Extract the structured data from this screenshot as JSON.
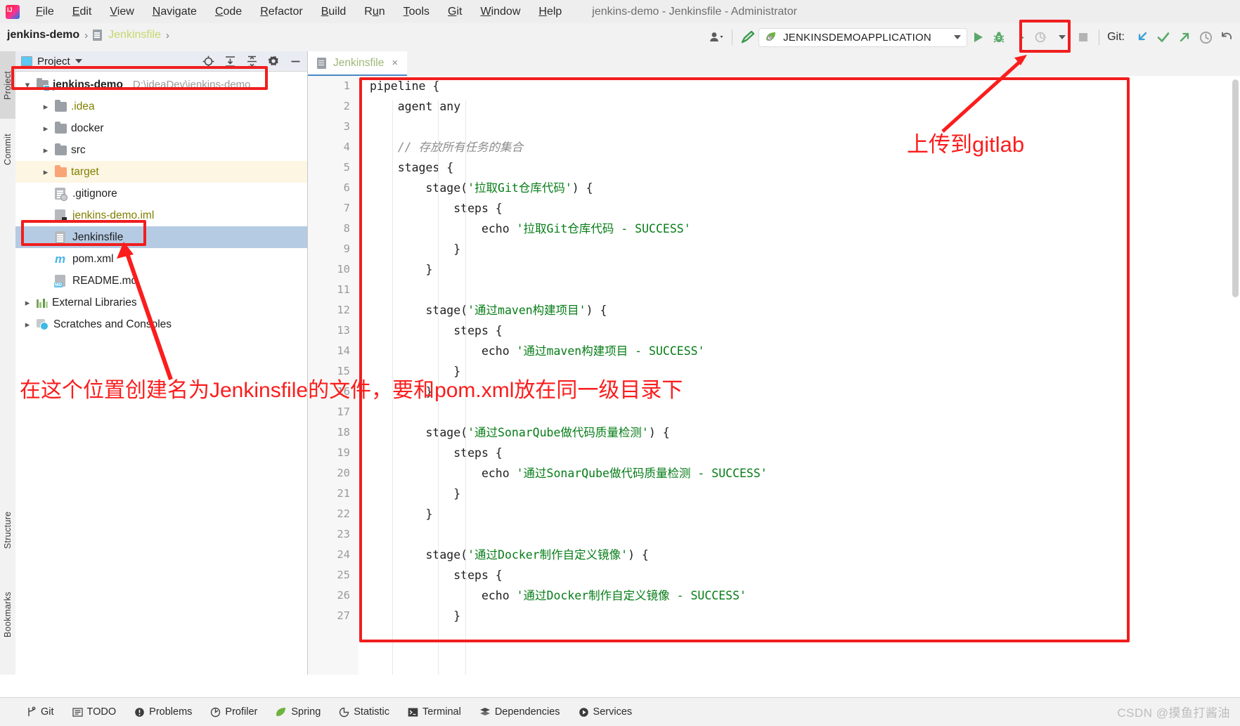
{
  "window": {
    "title": "jenkins-demo - Jenkinsfile - Administrator",
    "app_icon": "intellij-idea-logo"
  },
  "menu": {
    "items": [
      {
        "label": "File",
        "mnemonic": "F"
      },
      {
        "label": "Edit",
        "mnemonic": "E"
      },
      {
        "label": "View",
        "mnemonic": "V"
      },
      {
        "label": "Navigate",
        "mnemonic": "N"
      },
      {
        "label": "Code",
        "mnemonic": "C"
      },
      {
        "label": "Refactor",
        "mnemonic": "R"
      },
      {
        "label": "Build",
        "mnemonic": "B"
      },
      {
        "label": "Run",
        "mnemonic": "u"
      },
      {
        "label": "Tools",
        "mnemonic": "T"
      },
      {
        "label": "Git",
        "mnemonic": "G"
      },
      {
        "label": "Window",
        "mnemonic": "W"
      },
      {
        "label": "Help",
        "mnemonic": "H"
      }
    ]
  },
  "breadcrumb": {
    "project": "jenkins-demo",
    "separator": "›",
    "file": "Jenkinsfile",
    "trailing_separator": "›"
  },
  "toolbar": {
    "run_config": "JENKINSDEMOAPPLICATION",
    "git_label": "Git:",
    "icons": [
      "user-avatar-icon",
      "build-hammer-icon",
      "spring-leaf-icon",
      "run-icon",
      "debug-icon",
      "run-with-coverage-icon",
      "profile-icon",
      "stop-icon",
      "git-update-icon",
      "git-commit-icon",
      "git-push-icon",
      "history-icon",
      "undo-icon"
    ]
  },
  "left_strip": {
    "top": [
      "Project",
      "Commit"
    ],
    "bottom": [
      "Structure",
      "Bookmarks"
    ]
  },
  "project_panel": {
    "title": "Project",
    "header_icons": [
      "locate-icon",
      "expand-all-icon",
      "collapse-all-icon",
      "gear-icon",
      "minimize-icon"
    ],
    "tree": [
      {
        "label": "jenkins-demo",
        "path": "D:\\ideaDev\\jenkins-demo",
        "kind": "project-root",
        "indent": 0,
        "expanded": true,
        "bold": true,
        "highlighted": true
      },
      {
        "label": ".idea",
        "kind": "folder",
        "indent": 1,
        "expanded": false,
        "olive": true
      },
      {
        "label": "docker",
        "kind": "folder",
        "indent": 1,
        "expanded": false
      },
      {
        "label": "src",
        "kind": "folder",
        "indent": 1,
        "expanded": false
      },
      {
        "label": "target",
        "kind": "folder-excluded",
        "indent": 1,
        "expanded": false,
        "row_warn": true,
        "olive": true
      },
      {
        "label": ".gitignore",
        "kind": "file-ignored",
        "indent": 2
      },
      {
        "label": "jenkins-demo.iml",
        "kind": "file-iml",
        "indent": 2,
        "olive": true
      },
      {
        "label": "Jenkinsfile",
        "kind": "file-text",
        "indent": 2,
        "selected": true,
        "highlighted": true
      },
      {
        "label": "pom.xml",
        "kind": "file-maven",
        "indent": 2
      },
      {
        "label": "README.md",
        "kind": "file-markdown",
        "indent": 2
      },
      {
        "label": "External Libraries",
        "kind": "libraries",
        "indent": 0,
        "expanded": false
      },
      {
        "label": "Scratches and Consoles",
        "kind": "scratches",
        "indent": 0,
        "expanded": false
      }
    ]
  },
  "editor": {
    "tab": {
      "label": "Jenkinsfile",
      "close": "×",
      "icon": "text-file-icon"
    },
    "line_numbers": [
      1,
      2,
      3,
      4,
      5,
      6,
      7,
      8,
      9,
      10,
      11,
      12,
      13,
      14,
      15,
      16,
      17,
      18,
      19,
      20,
      21,
      22,
      23,
      24,
      25,
      26,
      27
    ],
    "lines": [
      {
        "n": 1,
        "text": "pipeline {"
      },
      {
        "n": 2,
        "text": "    agent any"
      },
      {
        "n": 3,
        "text": ""
      },
      {
        "n": 4,
        "text": "    // 存放所有任务的集合",
        "comment": true
      },
      {
        "n": 5,
        "text": "    stages {"
      },
      {
        "n": 6,
        "text": "        stage('拉取Git仓库代码') {"
      },
      {
        "n": 7,
        "text": "            steps {"
      },
      {
        "n": 8,
        "text": "                echo '拉取Git仓库代码 - SUCCESS'"
      },
      {
        "n": 9,
        "text": "            }"
      },
      {
        "n": 10,
        "text": "        }"
      },
      {
        "n": 11,
        "text": ""
      },
      {
        "n": 12,
        "text": "        stage('通过maven构建项目') {"
      },
      {
        "n": 13,
        "text": "            steps {"
      },
      {
        "n": 14,
        "text": "                echo '通过maven构建项目 - SUCCESS'"
      },
      {
        "n": 15,
        "text": "            }"
      },
      {
        "n": 16,
        "text": "        }"
      },
      {
        "n": 17,
        "text": ""
      },
      {
        "n": 18,
        "text": "        stage('通过SonarQube做代码质量检测') {"
      },
      {
        "n": 19,
        "text": "            steps {"
      },
      {
        "n": 20,
        "text": "                echo '通过SonarQube做代码质量检测 - SUCCESS'"
      },
      {
        "n": 21,
        "text": "            }"
      },
      {
        "n": 22,
        "text": "        }"
      },
      {
        "n": 23,
        "text": ""
      },
      {
        "n": 24,
        "text": "        stage('通过Docker制作自定义镜像') {"
      },
      {
        "n": 25,
        "text": "            steps {"
      },
      {
        "n": 26,
        "text": "                echo '通过Docker制作自定义镜像 - SUCCESS'"
      },
      {
        "n": 27,
        "text": "            }"
      }
    ]
  },
  "status_bar": {
    "items": [
      {
        "label": "Git",
        "icon": "git-branch-icon"
      },
      {
        "label": "TODO",
        "icon": "todo-list-icon"
      },
      {
        "label": "Problems",
        "icon": "problems-icon"
      },
      {
        "label": "Profiler",
        "icon": "profiler-icon"
      },
      {
        "label": "Spring",
        "icon": "spring-leaf-icon"
      },
      {
        "label": "Statistic",
        "icon": "statistic-icon"
      },
      {
        "label": "Terminal",
        "icon": "terminal-icon"
      },
      {
        "label": "Dependencies",
        "icon": "dependencies-icon"
      },
      {
        "label": "Services",
        "icon": "services-icon"
      }
    ],
    "watermark": "CSDN @摸鱼打酱油"
  },
  "annotations": {
    "color": "#fb1d1d",
    "upload_note": "上传到gitlab",
    "create_note": "在这个位置创建名为Jenkinsfile的文件，要和pom.xml放在同一级目录下",
    "boxes": [
      "project-root-row",
      "jenkinsfile-row",
      "git-commit-push-buttons",
      "editor-code-region"
    ]
  }
}
